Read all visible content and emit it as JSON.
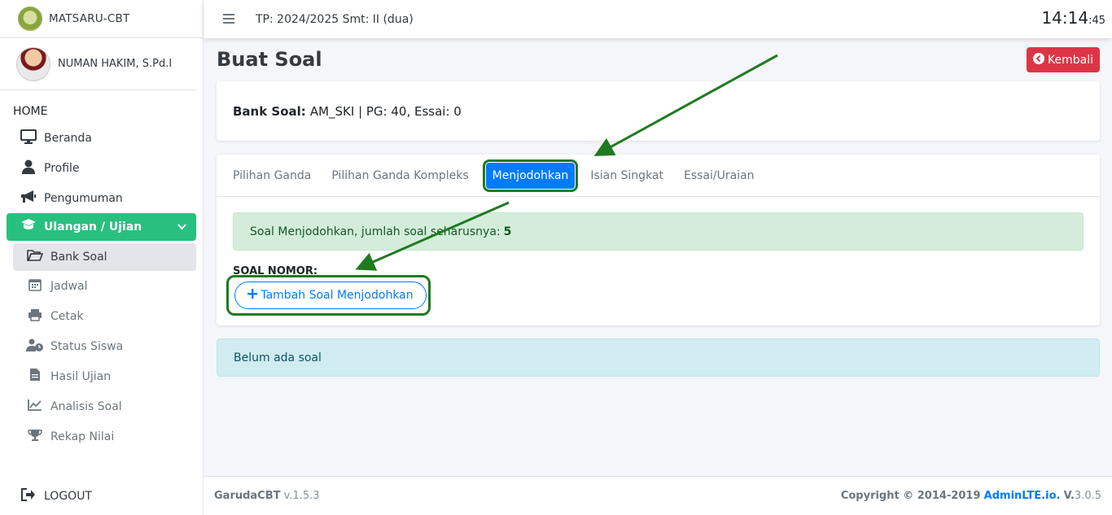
{
  "brand": {
    "name": "MATSARU-CBT"
  },
  "user": {
    "name": "NUMAN HAKIM, S.Pd.I"
  },
  "sidebar": {
    "header": "HOME",
    "items": [
      {
        "label": "Beranda",
        "icon": "monitor-icon"
      },
      {
        "label": "Profile",
        "icon": "user-icon"
      },
      {
        "label": "Pengumuman",
        "icon": "megaphone-icon"
      }
    ],
    "active_group": {
      "label": "Ulangan / Ujian",
      "icon": "graduation-cap-icon"
    },
    "sub_items": [
      {
        "label": "Bank Soal",
        "icon": "folder-open-icon"
      },
      {
        "label": "Jadwal",
        "icon": "calendar-icon"
      },
      {
        "label": "Cetak",
        "icon": "printer-icon"
      },
      {
        "label": "Status Siswa",
        "icon": "user-clock-icon"
      },
      {
        "label": "Hasil Ujian",
        "icon": "file-icon"
      },
      {
        "label": "Analisis Soal",
        "icon": "chart-line-icon"
      },
      {
        "label": "Rekap Nilai",
        "icon": "trophy-icon"
      }
    ],
    "logout": "LOGOUT"
  },
  "topbar": {
    "tp": "TP: 2024/2025 Smt: II (dua)",
    "clock_hm": "14:14",
    "clock_s": ":45"
  },
  "page": {
    "title": "Buat Soal",
    "back_label": "Kembali",
    "bank_label": "Bank Soal:",
    "bank_value": "AM_SKI | PG: 40, Essai: 0",
    "tabs": [
      "Pilihan Ganda",
      "Pilihan Ganda Kompleks",
      "Menjodohkan",
      "Isian Singkat",
      "Essai/Uraian"
    ],
    "alert_text": "Soal Menjodohkan, jumlah soal seharusnya:",
    "alert_count": "5",
    "soal_label": "SOAL NOMOR:",
    "add_button": "Tambah Soal Menjodohkan",
    "empty_text": "Belum ada soal"
  },
  "footer": {
    "app": "GarudaCBT",
    "version": "v.1.5.3",
    "copyright": "Copyright © 2014-2019",
    "link": "AdminLTE.io.",
    "v_label": "V.",
    "v_num": "3.0.5"
  },
  "colors": {
    "sidebar_active": "#28c07f",
    "primary": "#007bff",
    "danger": "#dc3545",
    "annotation": "#1f7a1f"
  }
}
